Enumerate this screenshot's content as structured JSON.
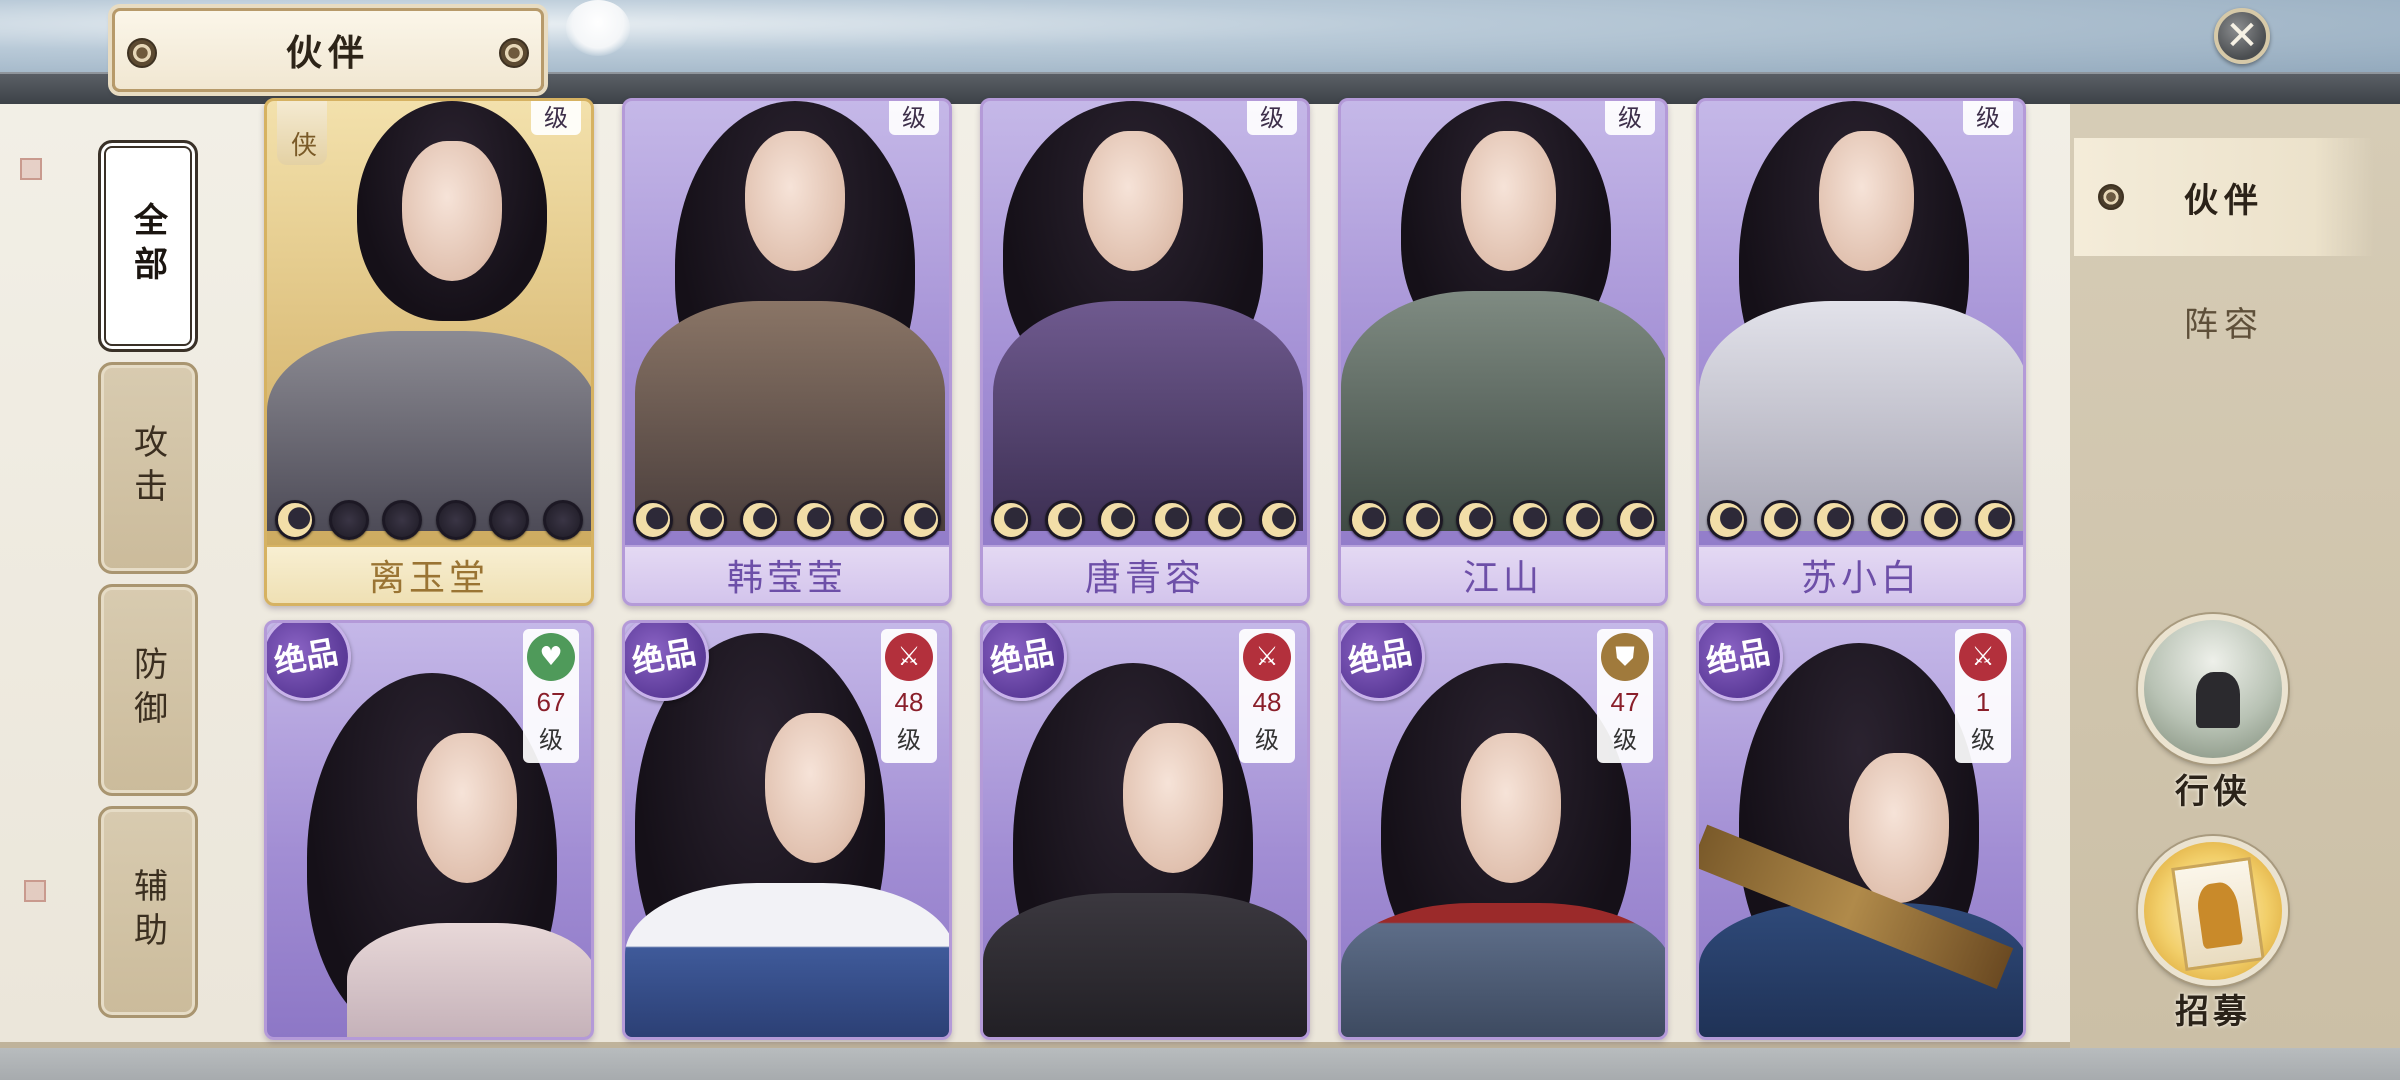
{
  "header": {
    "title": "伙伴",
    "close_symbol": "✕"
  },
  "filters": [
    {
      "label": "全部",
      "active": true
    },
    {
      "label": "攻击",
      "active": false
    },
    {
      "label": "防御",
      "active": false
    },
    {
      "label": "辅助",
      "active": false
    }
  ],
  "top_row_cards": [
    {
      "name": "离玉堂",
      "rank": "侠",
      "lvl_suffix": "级",
      "stars_lit": 1,
      "stars_total": 6,
      "style": "gold"
    },
    {
      "name": "韩莹莹",
      "lvl_suffix": "级",
      "stars_lit": 6,
      "stars_total": 6,
      "style": "purple"
    },
    {
      "name": "唐青容",
      "lvl_suffix": "级",
      "stars_lit": 6,
      "stars_total": 6,
      "style": "purple"
    },
    {
      "name": "江山",
      "lvl_suffix": "级",
      "stars_lit": 6,
      "stars_total": 6,
      "style": "purple"
    },
    {
      "name": "苏小白",
      "lvl_suffix": "级",
      "stars_lit": 6,
      "stars_total": 6,
      "style": "purple"
    }
  ],
  "bottom_row_cards": [
    {
      "quality": "绝品",
      "role_icon": "heart-icon",
      "role_color": "#4f9a5a",
      "level": "67",
      "level_suffix": "级"
    },
    {
      "quality": "绝品",
      "role_icon": "crossed-swords-icon",
      "role_color": "#b3303c",
      "level": "48",
      "level_suffix": "级"
    },
    {
      "quality": "绝品",
      "role_icon": "crossed-swords-icon",
      "role_color": "#b3303c",
      "level": "48",
      "level_suffix": "级"
    },
    {
      "quality": "绝品",
      "role_icon": "shield-icon",
      "role_color": "#a07a3c",
      "level": "47",
      "level_suffix": "级"
    },
    {
      "quality": "绝品",
      "role_icon": "crossed-swords-icon",
      "role_color": "#b3303c",
      "level": "1",
      "level_suffix": "级"
    }
  ],
  "right_tabs": [
    {
      "label": "伙伴",
      "active": true
    },
    {
      "label": "阵容",
      "active": false
    }
  ],
  "right_buttons": [
    {
      "label": "行侠"
    },
    {
      "label": "招募"
    }
  ]
}
